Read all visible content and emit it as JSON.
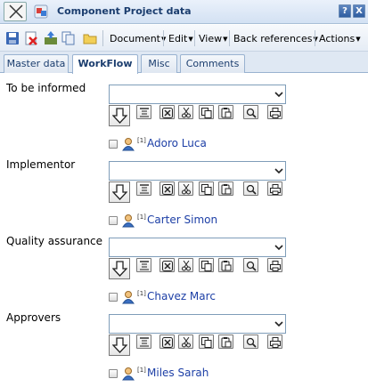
{
  "window": {
    "title": "Component Project data",
    "help_label": "?",
    "close_label": "X"
  },
  "toolbar": {
    "menus": [
      "Document",
      "Edit",
      "View",
      "Back references",
      "Actions"
    ]
  },
  "tabs": [
    "Master data",
    "WorkFlow",
    "Misc",
    "Comments"
  ],
  "active_tab": "WorkFlow",
  "roles": [
    {
      "label": "To be informed",
      "select_value": "",
      "person": {
        "index": "[1]",
        "name": "Adoro Luca"
      }
    },
    {
      "label": "Implementor",
      "select_value": "",
      "person": {
        "index": "[1]",
        "name": "Carter Simon"
      }
    },
    {
      "label": "Quality assurance",
      "select_value": "",
      "person": {
        "index": "[1]",
        "name": "Chavez Marc"
      }
    },
    {
      "label": "Approvers",
      "select_value": "",
      "person": {
        "index": "[1]",
        "name": "Miles Sarah"
      }
    }
  ],
  "row_actions": [
    "add-down-icon",
    "align-top-icon",
    "delete-icon",
    "cut-icon",
    "copy-icon",
    "paste-icon",
    "search-icon",
    "print-icon"
  ],
  "colors": {
    "accent": "#1b3d6e",
    "link": "#1d3fa6",
    "tab_bar": "#dfe8f3"
  }
}
